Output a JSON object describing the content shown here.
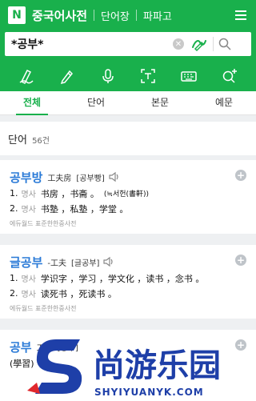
{
  "header": {
    "logo": "N",
    "title": "중국어사전",
    "links": [
      "단어장",
      "파파고"
    ]
  },
  "search": {
    "value": "*공부*"
  },
  "toolbar": {
    "icons": [
      "handwriting-icon",
      "pen-icon",
      "microphone-icon",
      "text-recognition-icon",
      "keyboard-icon",
      "add-search-icon"
    ]
  },
  "tabs": [
    "전체",
    "단어",
    "본문",
    "예문"
  ],
  "results": {
    "section_label": "단어",
    "count": "56건"
  },
  "entries": [
    {
      "headword": "공부방",
      "hanja": "工夫房",
      "pron": "[공부빵]",
      "senses": [
        {
          "num": "1.",
          "pos": "명사",
          "def": "书房 ，书斋 。",
          "note": "(≒서헌(書軒))"
        },
        {
          "num": "2.",
          "pos": "명사",
          "def": "书塾 ，私塾 ，学堂 。",
          "note": ""
        }
      ],
      "source": "에듀월드 표준한한중사전"
    },
    {
      "headword": "글공부",
      "hanja": "-工夫",
      "pron": "[글공부]",
      "senses": [
        {
          "num": "1.",
          "pos": "명사",
          "def": "学识字 ，学习 ，学文化 ，读书 ，念书 。",
          "note": ""
        },
        {
          "num": "2.",
          "pos": "명사",
          "def": "读死书 ，死读书 。",
          "note": ""
        }
      ],
      "source": "에듀월드 표준한한중사전"
    },
    {
      "headword": "공부",
      "hanja": "工夫",
      "pron": "[공부]",
      "senses": [
        {
          "num": "",
          "pos": "",
          "def": "(學習)",
          "note": ""
        }
      ],
      "source": ""
    }
  ],
  "watermark": {
    "brand": "尚游乐园",
    "url": "SHYIYUANYK.COM"
  },
  "colors": {
    "brand_green": "#19b04c",
    "link_blue": "#2a7ad7",
    "watermark_blue": "#1e3fa8",
    "watermark_red": "#e0282d"
  }
}
